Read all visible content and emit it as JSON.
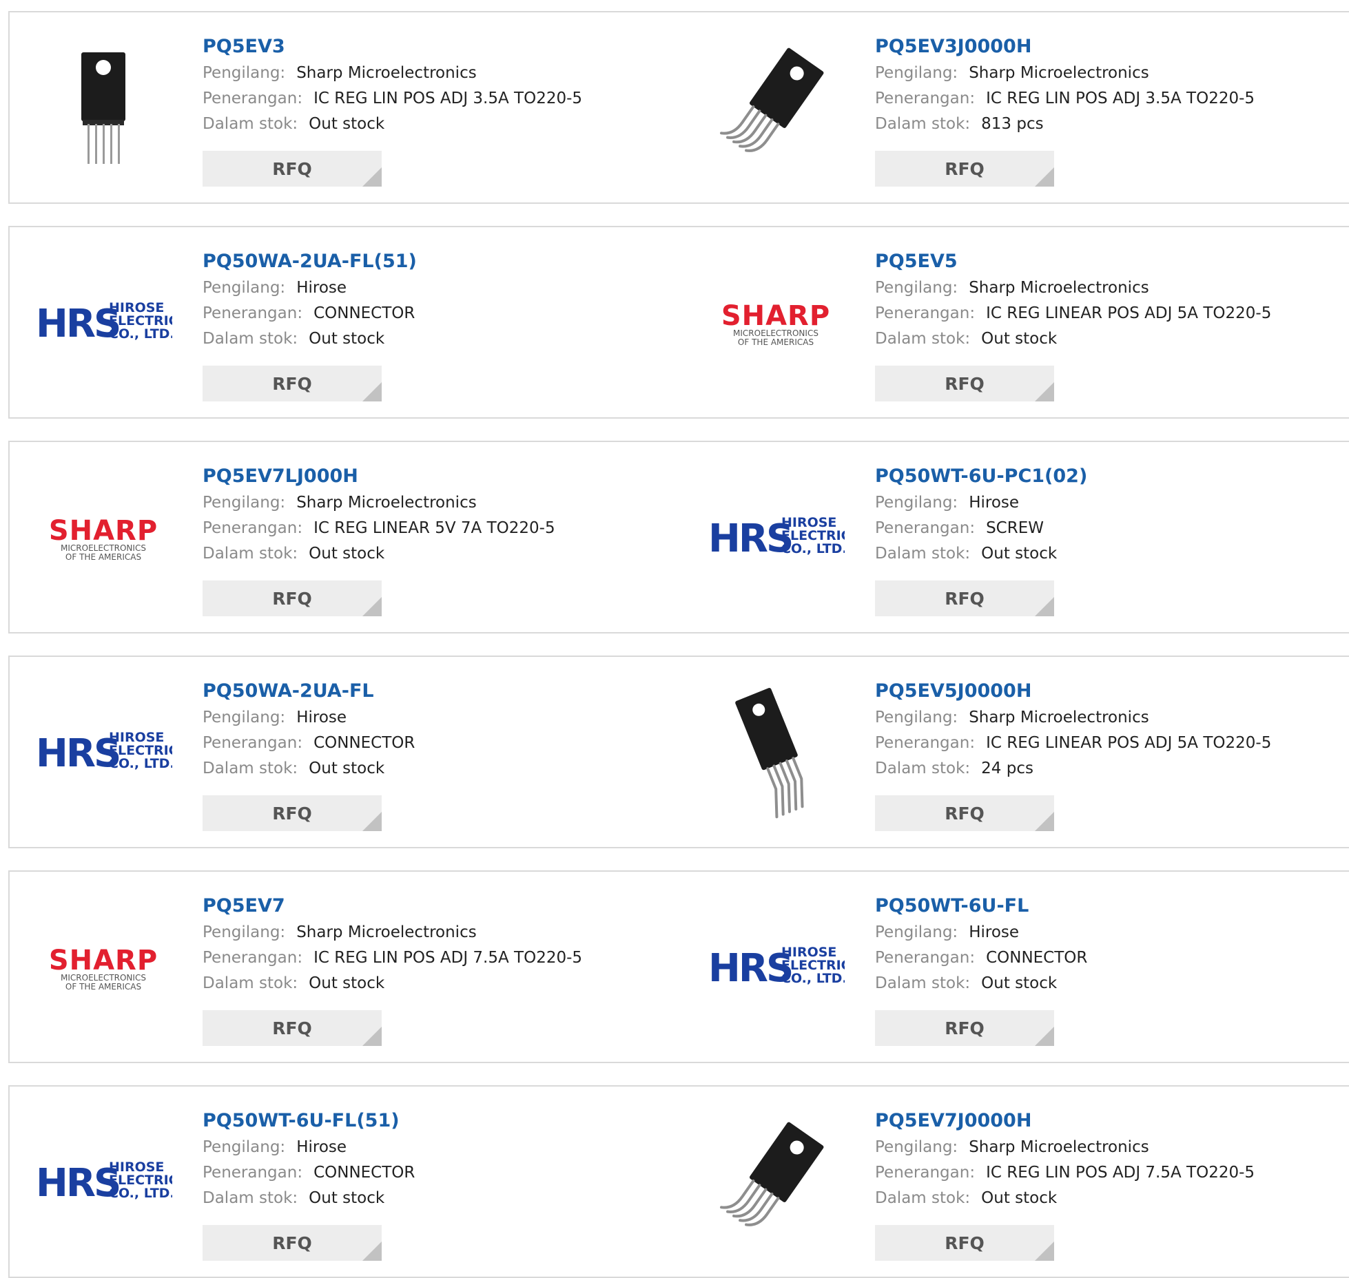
{
  "labels": {
    "manufacturer": "Pengilang:",
    "description": "Penerangan:",
    "stock": "Dalam stok:",
    "rfq": "RFQ"
  },
  "logos": {
    "sharp": {
      "name": "SHARP",
      "line1": "MICROELECTRONICS",
      "line2": "OF THE AMERICAS",
      "color": "#e2202f"
    },
    "hirose": {
      "name": "HRS",
      "line1": "HIROSE",
      "line2": "ELECTRIC",
      "line3": "CO., LTD.",
      "color": "#1a3fa0"
    }
  },
  "products": [
    {
      "part": "PQ5EV3",
      "manufacturer": "Sharp Microelectronics",
      "description": "IC REG LIN POS ADJ 3.5A TO220-5",
      "stock": "Out stock",
      "image": "to220-straight"
    },
    {
      "part": "PQ5EV3J0000H",
      "manufacturer": "Sharp Microelectronics",
      "description": "IC REG LIN POS ADJ 3.5A TO220-5",
      "stock": "813 pcs",
      "image": "to220-bent"
    },
    {
      "part": "PQ50WA-2UA-FL(51)",
      "manufacturer": "Hirose",
      "description": "CONNECTOR",
      "stock": "Out stock",
      "image": "hirose-logo"
    },
    {
      "part": "PQ5EV5",
      "manufacturer": "Sharp Microelectronics",
      "description": "IC REG LINEAR POS ADJ 5A TO220-5",
      "stock": "Out stock",
      "image": "sharp-logo"
    },
    {
      "part": "PQ5EV7LJ000H",
      "manufacturer": "Sharp Microelectronics",
      "description": "IC REG LINEAR 5V 7A TO220-5",
      "stock": "Out stock",
      "image": "sharp-logo"
    },
    {
      "part": "PQ50WT-6U-PC1(02)",
      "manufacturer": "Hirose",
      "description": "SCREW",
      "stock": "Out stock",
      "image": "hirose-logo"
    },
    {
      "part": "PQ50WA-2UA-FL",
      "manufacturer": "Hirose",
      "description": "CONNECTOR",
      "stock": "Out stock",
      "image": "hirose-logo"
    },
    {
      "part": "PQ5EV5J0000H",
      "manufacturer": "Sharp Microelectronics",
      "description": "IC REG LINEAR POS ADJ 5A TO220-5",
      "stock": "24 pcs",
      "image": "to220-slant"
    },
    {
      "part": "PQ5EV7",
      "manufacturer": "Sharp Microelectronics",
      "description": "IC REG LIN POS ADJ 7.5A TO220-5",
      "stock": "Out stock",
      "image": "sharp-logo"
    },
    {
      "part": "PQ50WT-6U-FL",
      "manufacturer": "Hirose",
      "description": "CONNECTOR",
      "stock": "Out stock",
      "image": "hirose-logo"
    },
    {
      "part": "PQ50WT-6U-FL(51)",
      "manufacturer": "Hirose",
      "description": "CONNECTOR",
      "stock": "Out stock",
      "image": "hirose-logo"
    },
    {
      "part": "PQ5EV7J0000H",
      "manufacturer": "Sharp Microelectronics",
      "description": "IC REG LIN POS ADJ 7.5A TO220-5",
      "stock": "Out stock",
      "image": "to220-bent"
    }
  ]
}
